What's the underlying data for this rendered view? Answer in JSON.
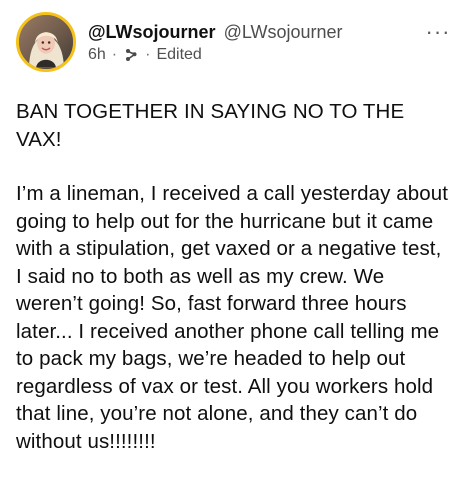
{
  "post": {
    "author": {
      "display_name": "@LWsojourner",
      "handle": "@LWsojourner",
      "avatar_icon": "profile-photo-icon"
    },
    "meta": {
      "time": "6h",
      "separator": "·",
      "privacy_icon": "share-icon",
      "edited": "Edited"
    },
    "more_icon": "more-options-icon",
    "more_label": "···",
    "paragraphs": [
      "BAN TOGETHER IN SAYING NO TO THE VAX!",
      "I’m a lineman, I received a call yesterday about going to help out for the hurricane but it came with a stipulation, get vaxed or a negative test, I said no to both as well as my crew. We weren’t going! So, fast forward three hours later... I received another phone call telling me to pack my bags, we’re headed to help out regardless of vax or test. All you workers hold that line, you’re not alone, and they can’t do without us!!!!!!!!"
    ]
  },
  "colors": {
    "avatar_ring": "#f4c21a",
    "text": "#0f0f0f",
    "muted": "#505050"
  }
}
